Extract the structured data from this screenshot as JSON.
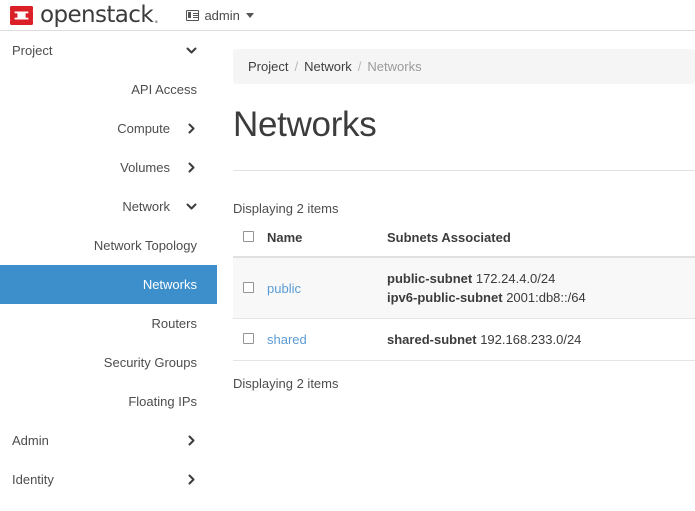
{
  "header": {
    "brand_name": "openstack",
    "brand_dot": ".",
    "logo_icon": "openstack-logo-icon",
    "user_icon": "user-card-icon",
    "user_label": "admin",
    "caret_icon": "caret-down-icon"
  },
  "sidebar": {
    "items": [
      {
        "label": "Project",
        "type": "group",
        "icon": "chevron-down-icon",
        "active": false,
        "level": 0
      },
      {
        "label": "API Access",
        "type": "link",
        "icon": "",
        "active": false,
        "level": 1
      },
      {
        "label": "Compute",
        "type": "group",
        "icon": "chevron-right-icon",
        "active": false,
        "level": 1
      },
      {
        "label": "Volumes",
        "type": "group",
        "icon": "chevron-right-icon",
        "active": false,
        "level": 1
      },
      {
        "label": "Network",
        "type": "group",
        "icon": "chevron-down-icon",
        "active": false,
        "level": 1
      },
      {
        "label": "Network Topology",
        "type": "link",
        "icon": "",
        "active": false,
        "level": 2
      },
      {
        "label": "Networks",
        "type": "link",
        "icon": "",
        "active": true,
        "level": 2
      },
      {
        "label": "Routers",
        "type": "link",
        "icon": "",
        "active": false,
        "level": 2
      },
      {
        "label": "Security Groups",
        "type": "link",
        "icon": "",
        "active": false,
        "level": 2
      },
      {
        "label": "Floating IPs",
        "type": "link",
        "icon": "",
        "active": false,
        "level": 2
      },
      {
        "label": "Admin",
        "type": "group",
        "icon": "chevron-right-icon",
        "active": false,
        "level": 0
      },
      {
        "label": "Identity",
        "type": "group",
        "icon": "chevron-right-icon",
        "active": false,
        "level": 0
      }
    ]
  },
  "breadcrumb": {
    "items": [
      "Project",
      "Network",
      "Networks"
    ],
    "separator": "/"
  },
  "page": {
    "title": "Networks"
  },
  "table": {
    "top_count": "Displaying 2 items",
    "bottom_count": "Displaying 2 items",
    "columns": [
      "",
      "Name",
      "Subnets Associated"
    ],
    "rows": [
      {
        "name": "public",
        "subnets": [
          {
            "name": "public-subnet",
            "cidr": "172.24.4.0/24"
          },
          {
            "name": "ipv6-public-subnet",
            "cidr": "2001:db8::/64"
          }
        ]
      },
      {
        "name": "shared",
        "subnets": [
          {
            "name": "shared-subnet",
            "cidr": "192.168.233.0/24"
          }
        ]
      }
    ]
  },
  "colors": {
    "active_nav": "#3d8fcc",
    "link": "#5b9bd5",
    "brand_red": "#da1f26",
    "text": "#3c3c3c",
    "muted": "#9b9b9b"
  }
}
